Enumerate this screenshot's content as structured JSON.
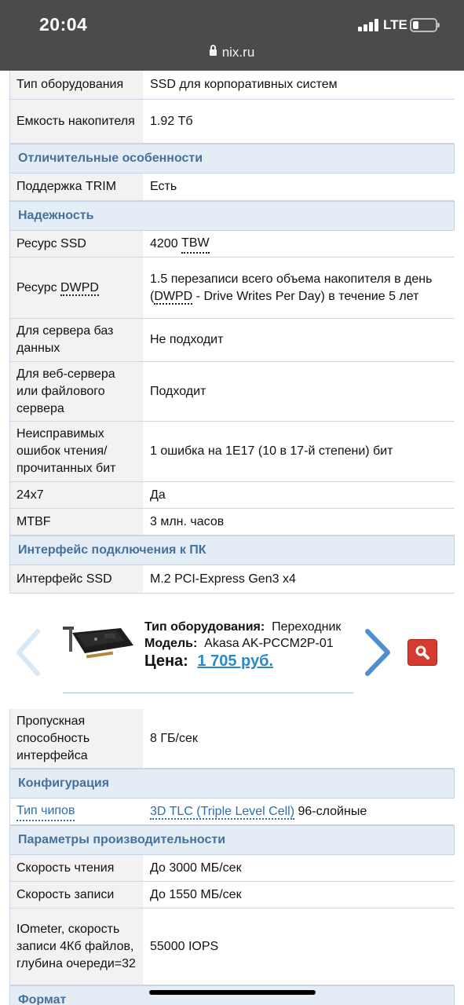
{
  "status_bar": {
    "time": "20:04",
    "network": "LTE"
  },
  "browser": {
    "url": "nix.ru"
  },
  "specs_top": [
    {
      "label": "Тип оборудования",
      "value": "SSD для корпоративных систем"
    },
    {
      "label": "Емкость накопителя",
      "value": "1.92 Тб"
    }
  ],
  "sections": {
    "features": "Отличительные особенности",
    "reliability": "Надежность",
    "interface": "Интерфейс подключения к ПК",
    "config": "Конфигурация",
    "performance": "Параметры производительности",
    "format": "Формат"
  },
  "features_rows": [
    {
      "label": "Поддержка TRIM",
      "value": "Есть"
    }
  ],
  "reliability_rows": {
    "resource_ssd": {
      "label": "Ресурс SSD",
      "value_prefix": "4200 ",
      "value_abbr": "TBW"
    },
    "dwpd": {
      "label_prefix": "Ресурс ",
      "label_abbr": "DWPD",
      "value_a": "1.5 перезаписи всего объема накопителя в день (",
      "value_abbr": "DWPD",
      "value_b": " - Drive Writes Per Day) в течение 5 лет"
    },
    "rows": [
      {
        "label": "Для сервера баз данных",
        "value": "Не подходит"
      },
      {
        "label": "Для веб-сервера или файлового сервера",
        "value": "Подходит"
      },
      {
        "label": "Неисправимых ошибок чтения/ прочитанных бит",
        "value": "1 ошибка на 1E17 (10 в 17-й степени) бит"
      },
      {
        "label": "24x7",
        "value": "Да"
      },
      {
        "label": "MTBF",
        "value": "3 млн. часов"
      }
    ]
  },
  "interface_rows": [
    {
      "label": "Интерфейс SSD",
      "value": "M.2 PCI-Express Gen3 x4"
    }
  ],
  "carousel": {
    "type_label": "Тип оборудования:",
    "type_value": "Переходник",
    "model_label": "Модель:",
    "model_value": "Akasa AK-PCCM2P-01",
    "price_label": "Цена:",
    "price_value": "1 705 руб."
  },
  "bandwidth_row": {
    "label": "Пропускная способность интерфейса",
    "value": "8 ГБ/сек"
  },
  "config_row": {
    "label": "Тип чипов",
    "value_link": "3D TLC (Triple Level Cell)",
    "value_rest": " 96-слойные"
  },
  "performance_rows": [
    {
      "label": "Скорость чтения",
      "value": "До 3000 МБ/сек"
    },
    {
      "label": "Скорость записи",
      "value": "До 1550 МБ/сек"
    },
    {
      "label": "IOmeter, скорость записи 4Кб файлов, глубина очереди=32",
      "value": "55000 IOPS"
    }
  ]
}
